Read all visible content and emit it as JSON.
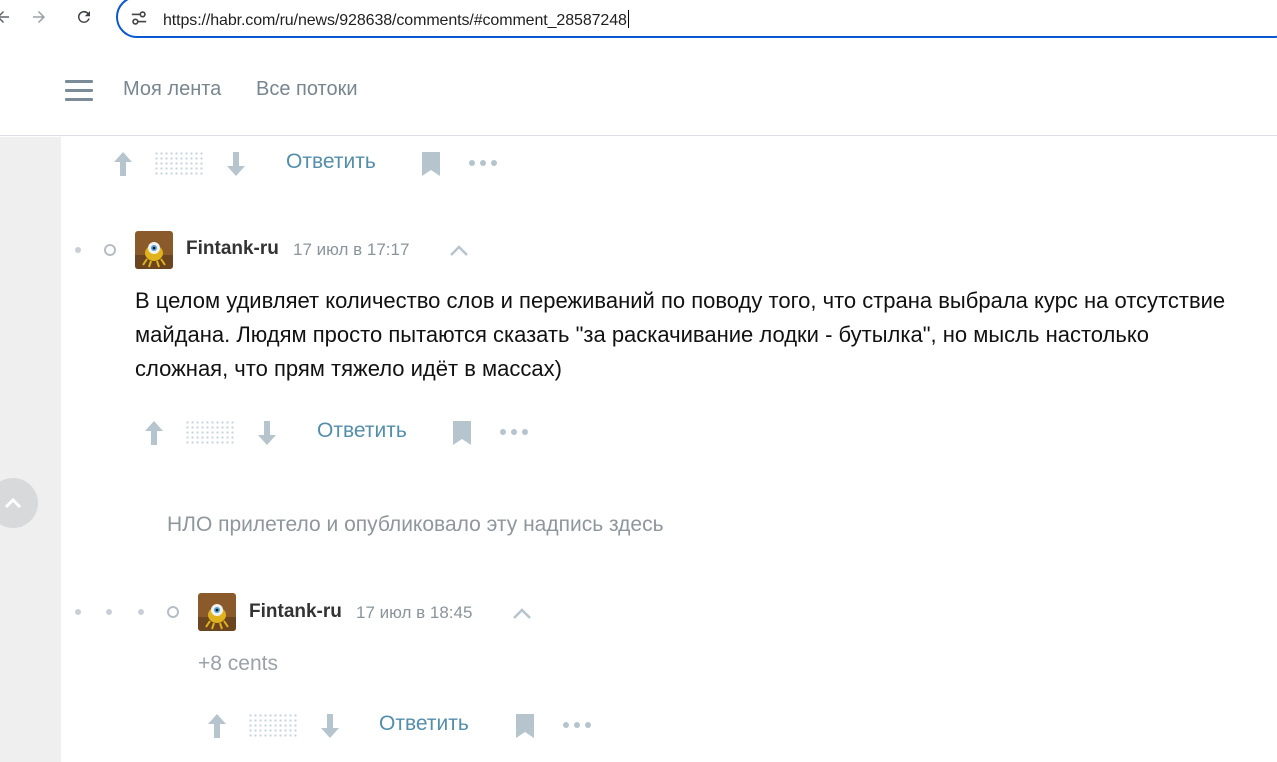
{
  "browser": {
    "url": "https://habr.com/ru/news/928638/comments/#comment_28587248",
    "icons": [
      "back-icon",
      "forward-icon",
      "reload-icon",
      "site-info-icon"
    ]
  },
  "topmenu": {
    "items": [
      {
        "label": "Моя лента"
      },
      {
        "label": "Все потоки"
      }
    ]
  },
  "actions": {
    "reply_label": "Ответить"
  },
  "comments": [
    {
      "author": "Fintank-ru",
      "time": "17 июл в 17:17",
      "text": "В целом удивляет количество слов и переживаний по поводу того, что страна выбрала курс на отсутствие майдана. Людям просто пытаются сказать \"за раскачивание лодки - бутылка\", но мысль настолько сложная, что прям тяжело идёт в массах)"
    },
    {
      "author": "Fintank-ru",
      "time": "17 июл в 18:45",
      "text": "+8 cents"
    }
  ],
  "ufo_note": "НЛО прилетело и опубликовало эту надпись здесь",
  "colors": {
    "accent_link": "#548eaa",
    "icon_gray": "#b6c4ce",
    "url_focus": "#0b57d0"
  }
}
